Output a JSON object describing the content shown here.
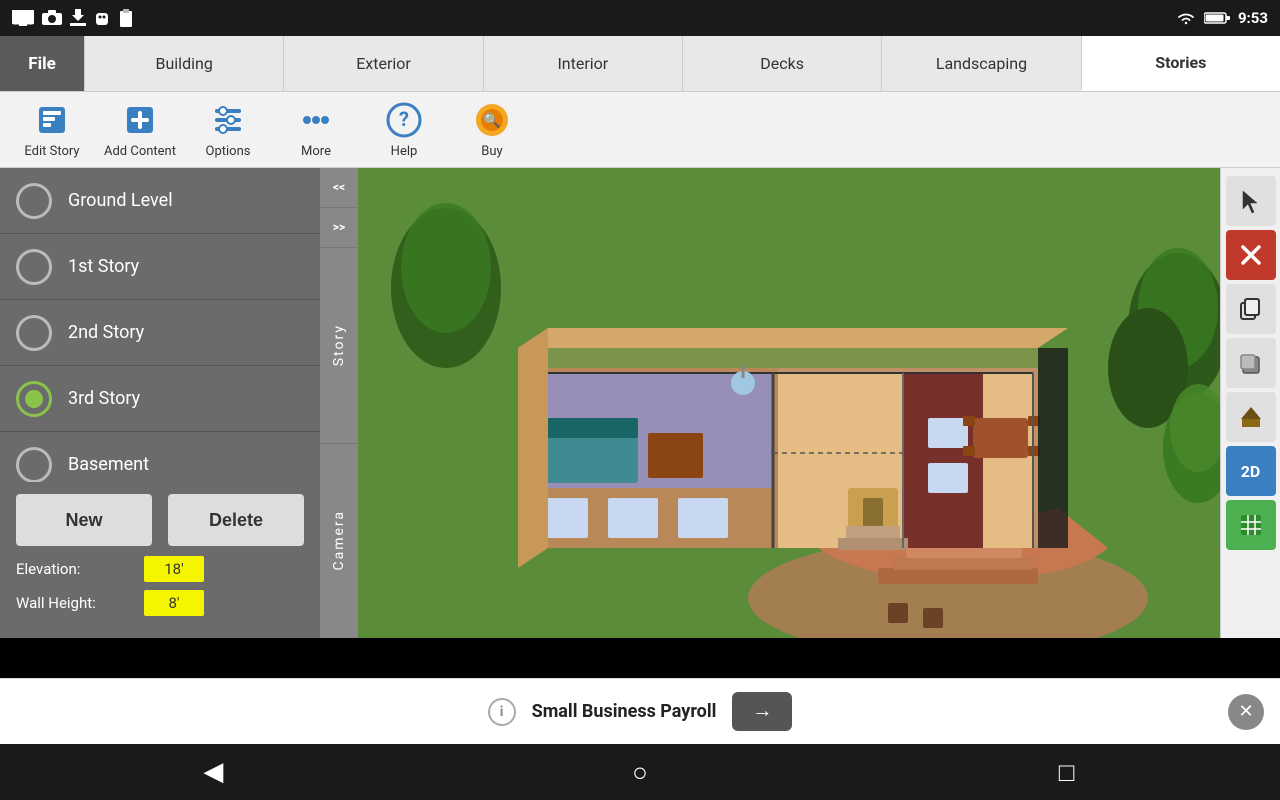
{
  "statusBar": {
    "time": "9:53",
    "icons": [
      "screen",
      "camera",
      "download",
      "app",
      "clipboard"
    ]
  },
  "navTabs": {
    "items": [
      {
        "label": "File",
        "active": false
      },
      {
        "label": "Building",
        "active": false
      },
      {
        "label": "Exterior",
        "active": false
      },
      {
        "label": "Interior",
        "active": false
      },
      {
        "label": "Decks",
        "active": false
      },
      {
        "label": "Landscaping",
        "active": false
      },
      {
        "label": "Stories",
        "active": true
      }
    ]
  },
  "toolbar": {
    "items": [
      {
        "label": "Edit Story",
        "icon": "edit"
      },
      {
        "label": "Add Content",
        "icon": "add"
      },
      {
        "label": "Options",
        "icon": "options"
      },
      {
        "label": "More",
        "icon": "more"
      },
      {
        "label": "Help",
        "icon": "help"
      },
      {
        "label": "Buy",
        "icon": "buy"
      }
    ]
  },
  "stories": {
    "items": [
      {
        "name": "Ground Level",
        "active": false
      },
      {
        "name": "1st Story",
        "active": false
      },
      {
        "name": "2nd Story",
        "active": false
      },
      {
        "name": "3rd Story",
        "active": true
      },
      {
        "name": "Basement",
        "active": false
      }
    ]
  },
  "sideTabs": {
    "storyLabel": "Story",
    "cameraLabel": "Camera",
    "arrows": [
      "<<",
      ">>"
    ]
  },
  "panelButtons": {
    "new": "New",
    "delete": "Delete"
  },
  "fields": {
    "elevation": {
      "label": "Elevation:",
      "value": "18'"
    },
    "wallHeight": {
      "label": "Wall Height:",
      "value": "8'"
    }
  },
  "rightToolbar": {
    "items": [
      {
        "icon": "cursor",
        "label": "select-tool"
      },
      {
        "icon": "delete",
        "label": "delete-tool"
      },
      {
        "icon": "copy",
        "label": "copy-tool"
      },
      {
        "icon": "3d-object",
        "label": "3d-tool"
      },
      {
        "icon": "roof",
        "label": "roof-tool"
      },
      {
        "icon": "2d",
        "label": "2d-view"
      },
      {
        "icon": "grid",
        "label": "grid-view"
      }
    ]
  },
  "adBar": {
    "text": "Small Business Payroll",
    "arrowLabel": "→",
    "closeLabel": "✕",
    "infoLabel": "i"
  },
  "navBar": {
    "back": "◀",
    "home": "○",
    "recent": "□"
  }
}
